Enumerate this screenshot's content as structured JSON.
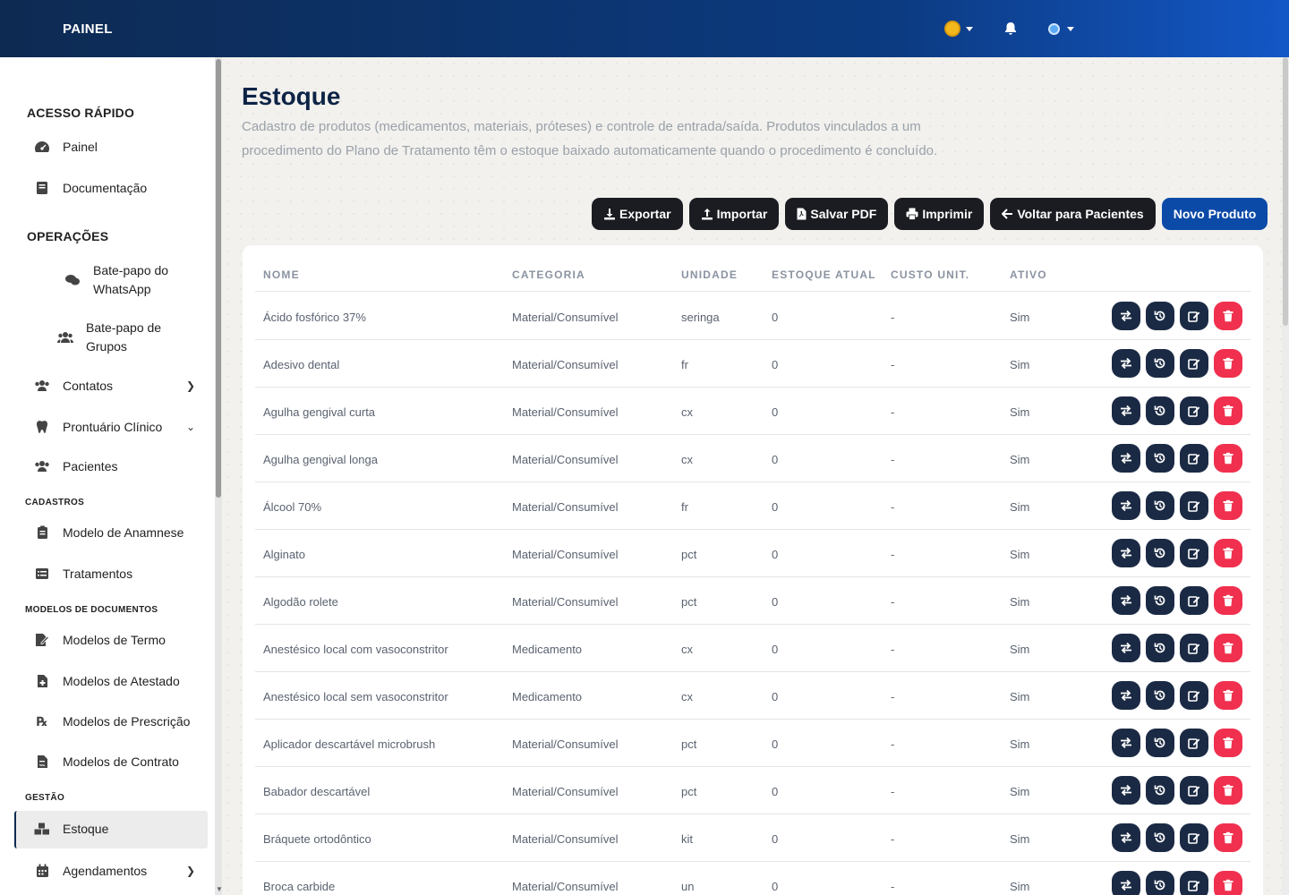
{
  "topbar": {
    "brand": "PAINEL"
  },
  "sidebar": {
    "quick_access_title": "ACESSO RÁPIDO",
    "operations_title": "OPERAÇÕES",
    "items": [
      {
        "label": "Painel"
      },
      {
        "label": "Documentação"
      },
      {
        "label": "Bate-papo do WhatsApp"
      },
      {
        "label": "Bate-papo de Grupos"
      },
      {
        "label": "Contatos"
      },
      {
        "label": "Prontuário Clínico"
      },
      {
        "label": "Pacientes"
      },
      {
        "label": "Modelo de Anamnese"
      },
      {
        "label": "Tratamentos"
      },
      {
        "label": "Modelos de Termo"
      },
      {
        "label": "Modelos de Atestado"
      },
      {
        "label": "Modelos de Prescrição"
      },
      {
        "label": "Modelos de Contrato"
      },
      {
        "label": "Estoque"
      },
      {
        "label": "Agendamentos"
      }
    ],
    "groups": {
      "cadastros": "CADASTROS",
      "modelos_documentos": "MODELOS DE DOCUMENTOS",
      "gestao": "GESTÃO"
    },
    "bate_papo_whatsapp_l1": "Bate-papo do",
    "bate_papo_whatsapp_l2": "WhatsApp",
    "bate_papo_grupos_l1": "Bate-papo de",
    "bate_papo_grupos_l2": "Grupos"
  },
  "page": {
    "title": "Estoque",
    "description": "Cadastro de produtos (medicamentos, materiais, próteses) e controle de entrada/saída. Produtos vinculados a um procedimento do Plano de Tratamento têm o estoque baixado automaticamente quando o procedimento é concluído."
  },
  "toolbar": {
    "export": "Exportar",
    "import": "Importar",
    "save_pdf": "Salvar PDF",
    "print": "Imprimir",
    "back": "Voltar para Pacientes",
    "new_product": "Novo Produto"
  },
  "table": {
    "headers": [
      "NOME",
      "CATEGORIA",
      "UNIDADE",
      "ESTOQUE ATUAL",
      "CUSTO UNIT.",
      "ATIVO"
    ],
    "rows": [
      [
        "Ácido fosfórico 37%",
        "Material/Consumível",
        "seringa",
        "0",
        "-",
        "Sim"
      ],
      [
        "Adesivo dental",
        "Material/Consumível",
        "fr",
        "0",
        "-",
        "Sim"
      ],
      [
        "Agulha gengival curta",
        "Material/Consumível",
        "cx",
        "0",
        "-",
        "Sim"
      ],
      [
        "Agulha gengival longa",
        "Material/Consumível",
        "cx",
        "0",
        "-",
        "Sim"
      ],
      [
        "Álcool 70%",
        "Material/Consumível",
        "fr",
        "0",
        "-",
        "Sim"
      ],
      [
        "Alginato",
        "Material/Consumível",
        "pct",
        "0",
        "-",
        "Sim"
      ],
      [
        "Algodão rolete",
        "Material/Consumível",
        "pct",
        "0",
        "-",
        "Sim"
      ],
      [
        "Anestésico local com vasoconstritor",
        "Medicamento",
        "cx",
        "0",
        "-",
        "Sim"
      ],
      [
        "Anestésico local sem vasoconstritor",
        "Medicamento",
        "cx",
        "0",
        "-",
        "Sim"
      ],
      [
        "Aplicador descartável microbrush",
        "Material/Consumível",
        "pct",
        "0",
        "-",
        "Sim"
      ],
      [
        "Babador descartável",
        "Material/Consumível",
        "pct",
        "0",
        "-",
        "Sim"
      ],
      [
        "Bráquete ortodôntico",
        "Material/Consumível",
        "kit",
        "0",
        "-",
        "Sim"
      ],
      [
        "Broca carbide",
        "Material/Consumível",
        "un",
        "0",
        "-",
        "Sim"
      ]
    ]
  },
  "colors": {
    "topbar_start": "#0d2a52",
    "topbar_end": "#1357c6",
    "primary": "#0c4aa8",
    "danger": "#f0304e",
    "action": "#1b2a44"
  },
  "icons": [
    "sun-icon",
    "bell-icon",
    "globe-icon",
    "transfer-icon",
    "history-icon",
    "edit-icon",
    "trash-icon"
  ]
}
